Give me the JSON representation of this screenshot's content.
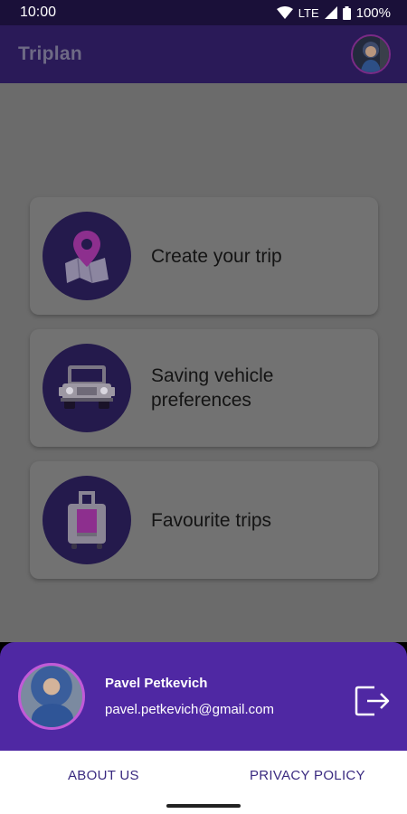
{
  "status": {
    "time": "10:00",
    "network": "LTE",
    "battery": "100%"
  },
  "app": {
    "title": "Triplan"
  },
  "menu": {
    "items": [
      {
        "label_line1": "Create your trip",
        "label_line2": "",
        "icon": "map-pin-icon"
      },
      {
        "label_line1": "Saving vehicle",
        "label_line2": "preferences",
        "icon": "jeep-icon"
      },
      {
        "label_line1": "Favourite trips",
        "label_line2": "",
        "icon": "suitcase-icon"
      }
    ]
  },
  "user": {
    "name": "Pavel Petkevich",
    "email": "pavel.petkevich@gmail.com"
  },
  "footer": {
    "about": "ABOUT US",
    "privacy": "PRIVACY POLICY"
  },
  "colors": {
    "accent": "#4f28a3",
    "app_bar": "#2a1a58",
    "icon_circle": "#241a4c",
    "pink": "#c02bb0"
  }
}
